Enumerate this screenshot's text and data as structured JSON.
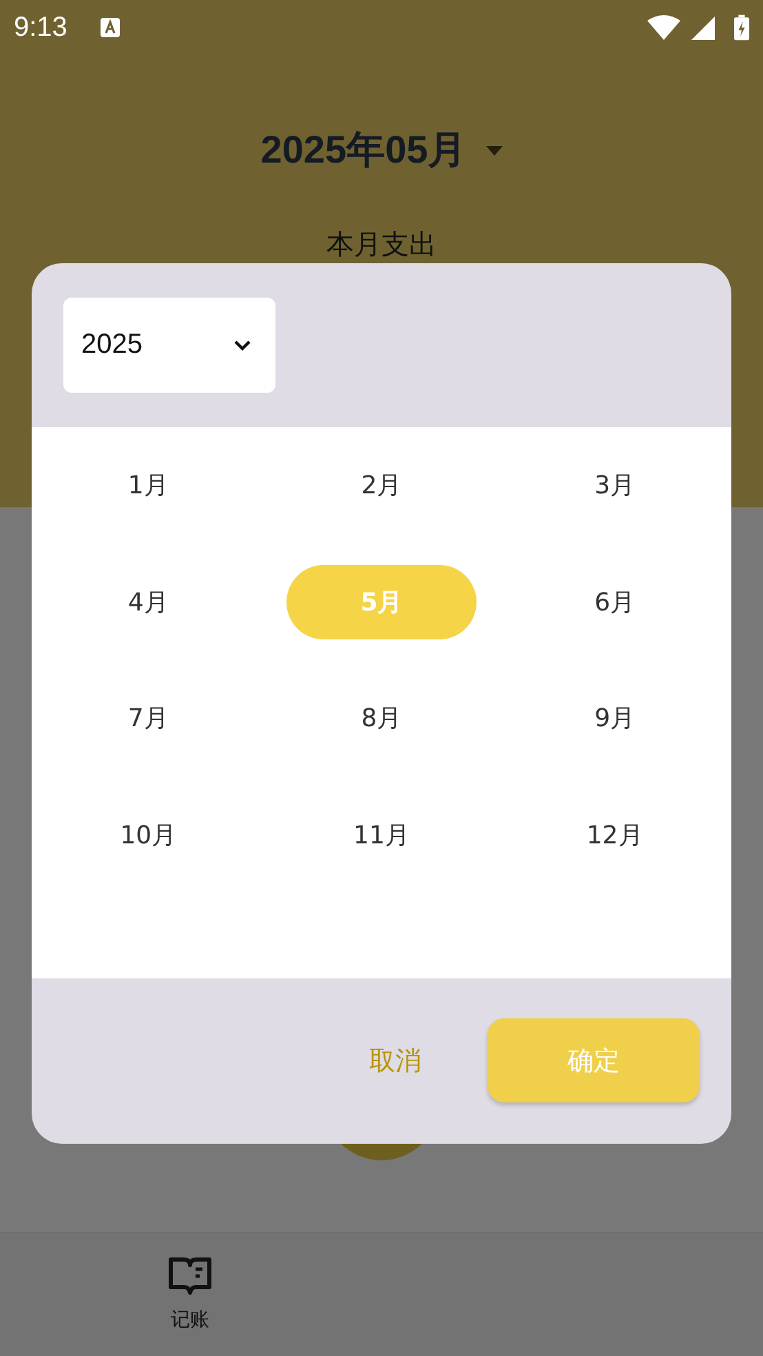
{
  "status_bar": {
    "time": "9:13"
  },
  "header": {
    "title": "2025年05月",
    "subtitle": "本月支出"
  },
  "dialog": {
    "year": "2025",
    "months": [
      {
        "label": "1月",
        "selected": false
      },
      {
        "label": "2月",
        "selected": false
      },
      {
        "label": "3月",
        "selected": false
      },
      {
        "label": "4月",
        "selected": false
      },
      {
        "label": "5月",
        "selected": true
      },
      {
        "label": "6月",
        "selected": false
      },
      {
        "label": "7月",
        "selected": false
      },
      {
        "label": "8月",
        "selected": false
      },
      {
        "label": "9月",
        "selected": false
      },
      {
        "label": "10月",
        "selected": false
      },
      {
        "label": "11月",
        "selected": false
      },
      {
        "label": "12月",
        "selected": false
      }
    ],
    "buttons": [
      {
        "label": "取消",
        "kind": "text"
      },
      {
        "label": "确定",
        "kind": "filled"
      }
    ]
  },
  "bottom_nav": [
    {
      "label": "记账"
    }
  ]
}
